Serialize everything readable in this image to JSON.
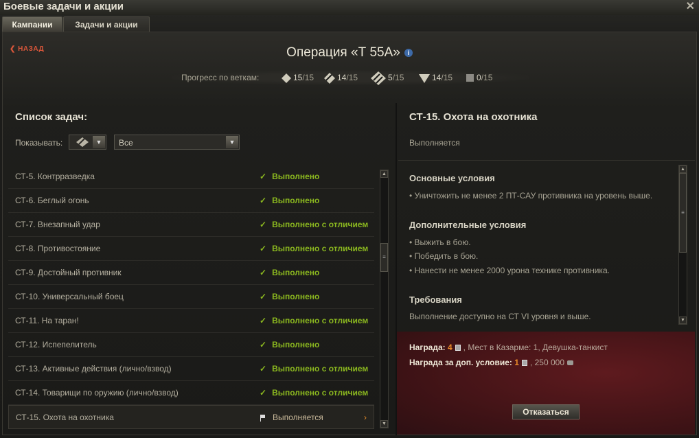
{
  "window": {
    "title": "Боевые задачи и акции",
    "close_glyph": "✕"
  },
  "tabs": [
    {
      "label": "Кампании",
      "active": true
    },
    {
      "label": "Задачи и акции",
      "active": false
    }
  ],
  "back": {
    "label": "НАЗАД",
    "glyph": "❮"
  },
  "operation": {
    "title": "Операция «Т 55А»",
    "info_glyph": "i"
  },
  "progress": {
    "label": "Прогресс по веткам:",
    "branches": [
      {
        "icon": "light-tank-icon",
        "done": "15",
        "total": "/15"
      },
      {
        "icon": "medium-tank-icon",
        "done": "14",
        "total": "/15"
      },
      {
        "icon": "heavy-tank-icon",
        "done": "5",
        "total": "/15"
      },
      {
        "icon": "tank-destroyer-icon",
        "done": "14",
        "total": "/15"
      },
      {
        "icon": "spg-icon",
        "done": "0",
        "total": "/15"
      }
    ]
  },
  "left": {
    "heading": "Список задач:",
    "show_label": "Показывать:",
    "filter_value": "Все",
    "tasks": [
      {
        "name": "СТ-5. Контрразведка",
        "status": "Выполнено"
      },
      {
        "name": "СТ-6. Беглый огонь",
        "status": "Выполнено"
      },
      {
        "name": "СТ-7. Внезапный удар",
        "status": "Выполнено с отличием"
      },
      {
        "name": "СТ-8. Противостояние",
        "status": "Выполнено с отличием"
      },
      {
        "name": "СТ-9. Достойный противник",
        "status": "Выполнено"
      },
      {
        "name": "СТ-10. Универсальный боец",
        "status": "Выполнено"
      },
      {
        "name": "СТ-11. На таран!",
        "status": "Выполнено с отличием"
      },
      {
        "name": "СТ-12. Испепелитель",
        "status": "Выполнено"
      },
      {
        "name": "СТ-13. Активные действия (лично/взвод)",
        "status": "Выполнено с отличием"
      },
      {
        "name": "СТ-14. Товарищи по оружию (лично/взвод)",
        "status": "Выполнено с отличием"
      },
      {
        "name": "СТ-15. Охота на охотника",
        "status": "Выполняется",
        "selected": true
      }
    ]
  },
  "right": {
    "title": "СТ-15. Охота на охотника",
    "status": "Выполняется",
    "main_head": "Основные условия",
    "main_items": [
      "• Уничтожить не менее 2 ПТ-САУ противника на уровень выше."
    ],
    "extra_head": "Дополнительные условия",
    "extra_items": [
      "• Выжить в бою.",
      "• Победить в бою.",
      "• Нанести не менее 2000 урона технике противника."
    ],
    "req_head": "Требования",
    "req_text": "Выполнение доступно на СТ VI уровня и выше.",
    "reward_label": "Награда:",
    "reward_num": "4",
    "reward_rest": ", Мест в Казарме: 1, Девушка-танкист",
    "bonus_label": "Награда за доп. условие:",
    "bonus_num": "1",
    "bonus_rest": ", 250 000",
    "refuse_label": "Отказаться"
  },
  "colors": {
    "done": "#8bb81f",
    "accent": "#e98a2a",
    "back": "#d8563a",
    "reward_bg": "#4a1519"
  }
}
